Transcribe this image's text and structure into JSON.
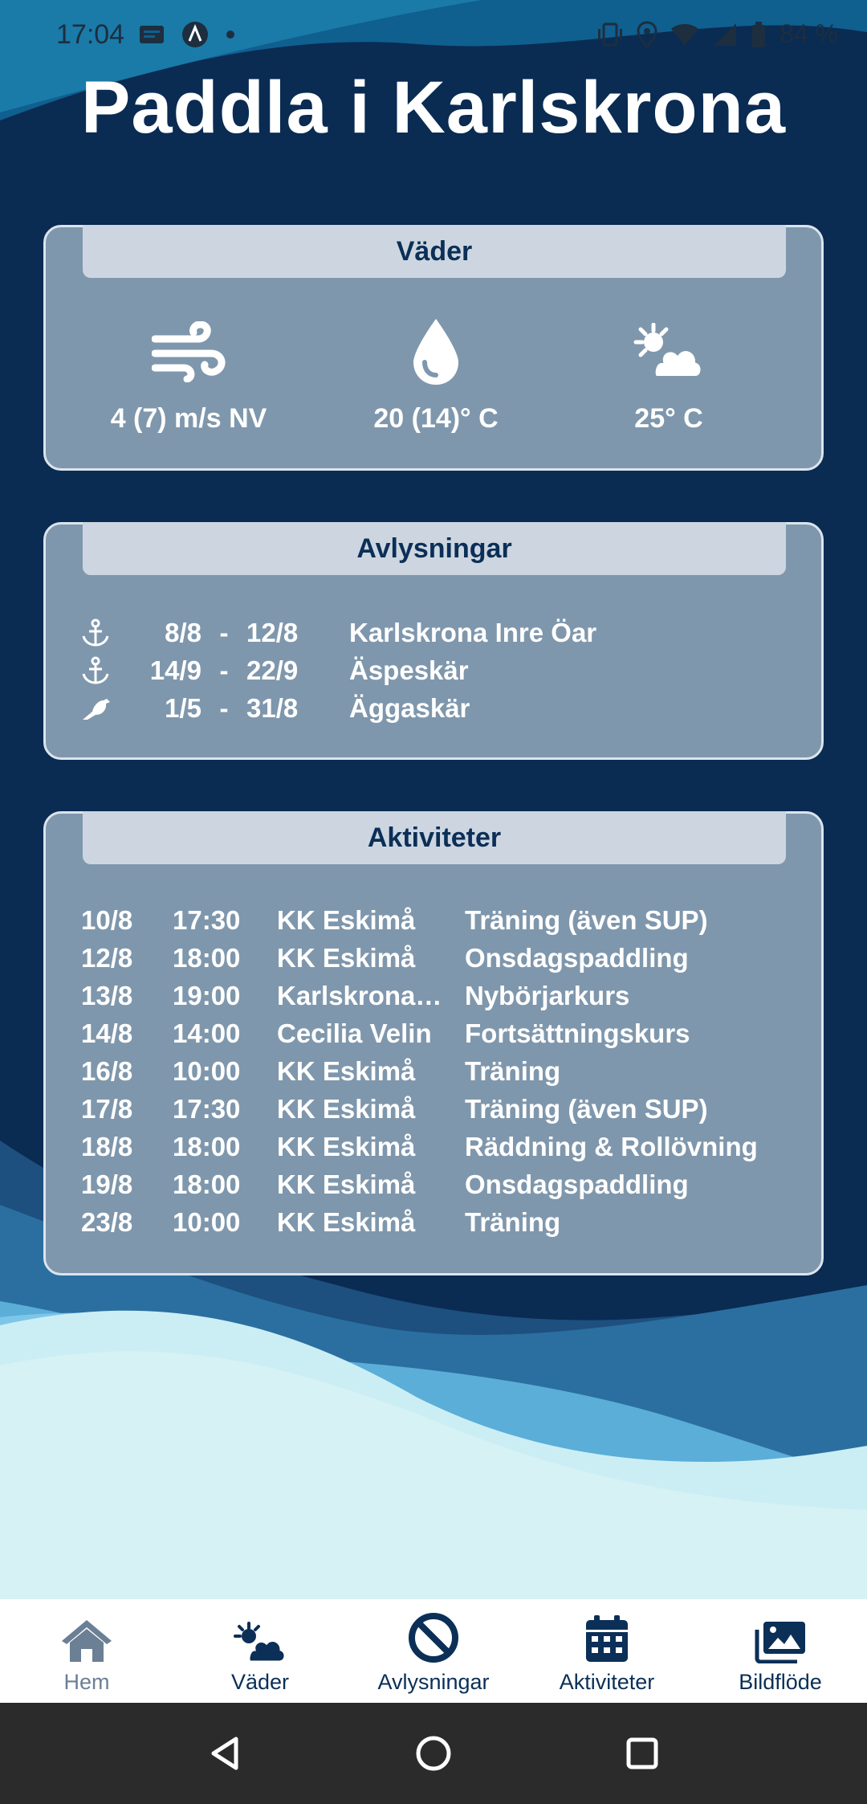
{
  "status_bar": {
    "time": "17:04",
    "battery": "84 %"
  },
  "app_title": "Paddla i Karlskrona",
  "weather": {
    "header": "Väder",
    "items": [
      {
        "icon": "wind-icon",
        "value": "4 (7) m/s NV"
      },
      {
        "icon": "water-drop-icon",
        "value": "20 (14)° C"
      },
      {
        "icon": "sun-cloud-icon",
        "value": "25° C"
      }
    ]
  },
  "cancellations": {
    "header": "Avlysningar",
    "rows": [
      {
        "icon": "anchor-icon",
        "from": "8/8",
        "dash": "-",
        "to": "12/8",
        "place": "Karlskrona Inre Öar"
      },
      {
        "icon": "anchor-icon",
        "from": "14/9",
        "dash": "-",
        "to": "22/9",
        "place": "Äspeskär"
      },
      {
        "icon": "bird-icon",
        "from": "1/5",
        "dash": "-",
        "to": "31/8",
        "place": "Äggaskär"
      }
    ]
  },
  "activities": {
    "header": "Aktiviteter",
    "rows": [
      {
        "date": "10/8",
        "time": "17:30",
        "club": "KK Eskimå",
        "what": "Träning (även SUP)"
      },
      {
        "date": "12/8",
        "time": "18:00",
        "club": "KK Eskimå",
        "what": "Onsdagspaddling"
      },
      {
        "date": "13/8",
        "time": "19:00",
        "club": "Karlskrona…",
        "what": "Nybörjarkurs"
      },
      {
        "date": "14/8",
        "time": "14:00",
        "club": "Cecilia Velin",
        "what": "Fortsättningskurs"
      },
      {
        "date": "16/8",
        "time": "10:00",
        "club": "KK Eskimå",
        "what": "Träning"
      },
      {
        "date": "17/8",
        "time": "17:30",
        "club": "KK Eskimå",
        "what": "Träning (även SUP)"
      },
      {
        "date": "18/8",
        "time": "18:00",
        "club": "KK Eskimå",
        "what": "Räddning & Rollövning"
      },
      {
        "date": "19/8",
        "time": "18:00",
        "club": "KK Eskimå",
        "what": "Onsdagspaddling"
      },
      {
        "date": "23/8",
        "time": "10:00",
        "club": "KK Eskimå",
        "what": "Träning"
      }
    ]
  },
  "bottom_nav": [
    {
      "label": "Hem",
      "icon": "home-icon",
      "active": true
    },
    {
      "label": "Väder",
      "icon": "weather-icon"
    },
    {
      "label": "Avlysningar",
      "icon": "prohibited-icon"
    },
    {
      "label": "Aktiviteter",
      "icon": "calendar-icon"
    },
    {
      "label": "Bildflöde",
      "icon": "images-icon"
    }
  ],
  "colors": {
    "navy": "#0b2f57",
    "card": "#7f97ac",
    "card_header": "#cdd6e0",
    "active_nav": "#6b7f95"
  }
}
